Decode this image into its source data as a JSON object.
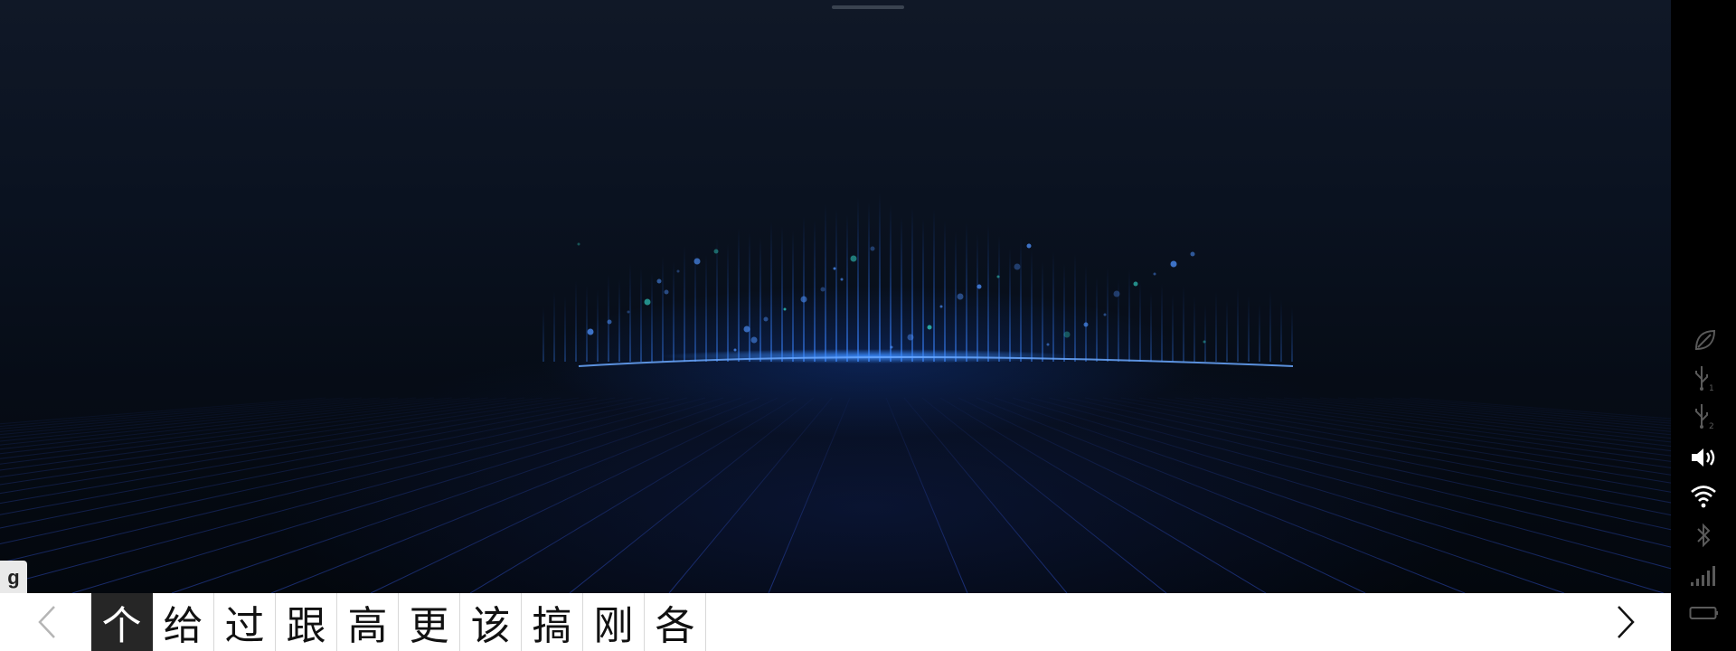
{
  "keyboard": {
    "typed_key": "g",
    "candidates": [
      "个",
      "给",
      "过",
      "跟",
      "高",
      "更",
      "该",
      "搞",
      "刚",
      "各"
    ],
    "selected_index": 0
  },
  "status_icons": [
    {
      "icon": "leaf-icon",
      "active": false
    },
    {
      "icon": "usb-1-icon",
      "active": false
    },
    {
      "icon": "usb-2-icon",
      "active": false
    },
    {
      "icon": "volume-icon",
      "active": true
    },
    {
      "icon": "wifi-icon",
      "active": true
    },
    {
      "icon": "bluetooth-icon",
      "active": false
    },
    {
      "icon": "signal-icon",
      "active": false
    },
    {
      "icon": "battery-icon",
      "active": false
    }
  ],
  "colors": {
    "background": "#060c16",
    "glow": "#2a7bff",
    "candidate_selected_bg": "#262626",
    "candidate_bar_bg": "#ffffff",
    "status_active": "#ffffff",
    "status_inactive": "#5a5a5a"
  }
}
